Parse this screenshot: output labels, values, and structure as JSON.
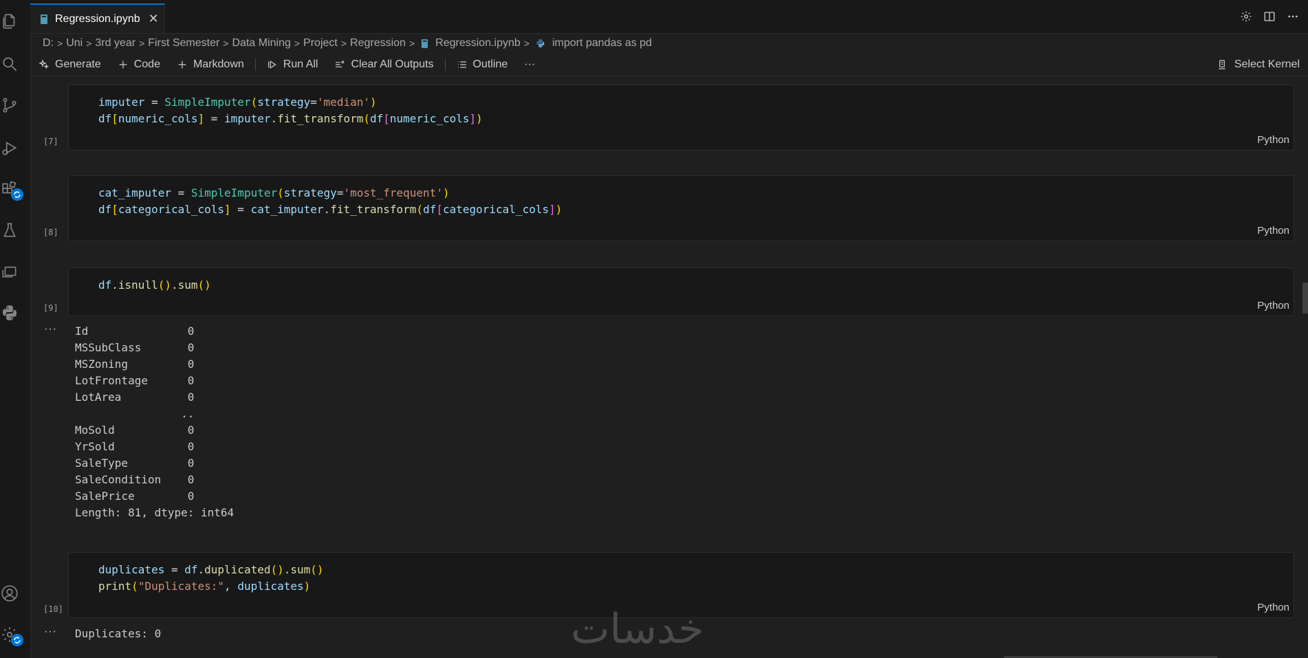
{
  "tab": {
    "title": "Regression.ipynb",
    "close": "✕"
  },
  "breadcrumb": {
    "parts": [
      "D:",
      "Uni",
      "3rd year",
      "First Semester",
      "Data Mining",
      "Project",
      "Regression",
      "Regression.ipynb",
      "import pandas as pd"
    ],
    "separator": ">"
  },
  "toolbar": {
    "generate": "Generate",
    "code": "Code",
    "markdown": "Markdown",
    "run_all": "Run All",
    "clear_outputs": "Clear All Outputs",
    "outline": "Outline",
    "more": "···",
    "select_kernel": "Select Kernel"
  },
  "cells": [
    {
      "exec": "[7]",
      "lang": "Python",
      "line1": {
        "a": "imputer",
        "b": " = ",
        "c": "SimpleImputer",
        "d": "(",
        "e": "strategy",
        "f": "=",
        "g": "'median'",
        "h": ")"
      },
      "line2": {
        "a": "df",
        "b": "[",
        "c": "numeric_cols",
        "d": "]",
        "e": " = ",
        "f": "imputer",
        "g": ".",
        "h": "fit_transform",
        "i": "(",
        "j": "df",
        "k": "[",
        "l": "numeric_cols",
        "m": "]",
        "n": ")"
      }
    },
    {
      "exec": "[8]",
      "lang": "Python",
      "line1": {
        "a": "cat_imputer",
        "b": " = ",
        "c": "SimpleImputer",
        "d": "(",
        "e": "strategy",
        "f": "=",
        "g": "'most_frequent'",
        "h": ")"
      },
      "line2": {
        "a": "df",
        "b": "[",
        "c": "categorical_cols",
        "d": "]",
        "e": " = ",
        "f": "cat_imputer",
        "g": ".",
        "h": "fit_transform",
        "i": "(",
        "j": "df",
        "k": "[",
        "l": "categorical_cols",
        "m": "]",
        "n": ")"
      }
    },
    {
      "exec": "[9]",
      "lang": "Python",
      "line1": {
        "a": "df",
        "b": ".",
        "c": "isnull",
        "d": "()",
        "e": ".",
        "f": "sum",
        "g": "()"
      },
      "output": [
        "Id               0",
        "MSSubClass       0",
        "MSZoning         0",
        "LotFrontage      0",
        "LotArea          0",
        "                ..",
        "MoSold           0",
        "YrSold           0",
        "SaleType         0",
        "SaleCondition    0",
        "SalePrice        0",
        "Length: 81, dtype: int64"
      ]
    },
    {
      "exec": "[10]",
      "lang": "Python",
      "line1": {
        "a": "duplicates",
        "b": " = ",
        "c": "df",
        "d": ".",
        "e": "duplicated",
        "f": "()",
        "g": ".",
        "h": "sum",
        "i": "()"
      },
      "line2": {
        "a": "print",
        "b": "(",
        "c": "\"Duplicates:\"",
        "d": ", ",
        "e": "duplicates",
        "f": ")"
      },
      "output": [
        "Duplicates: 0"
      ]
    }
  ],
  "output_more": "···",
  "watermark": "خدسات"
}
